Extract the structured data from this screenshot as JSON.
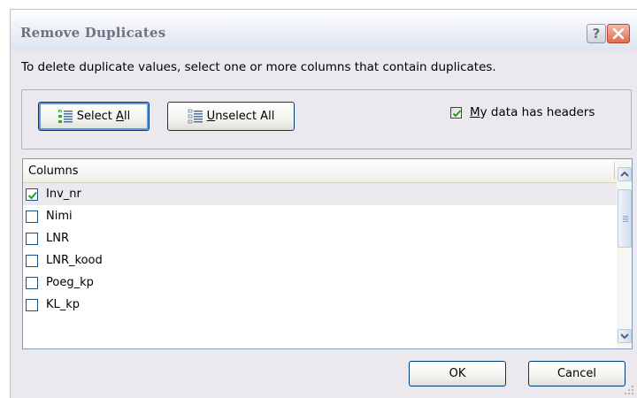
{
  "dialog": {
    "title": "Remove Duplicates",
    "help_label": "?",
    "instructions": "To delete duplicate values, select one or more columns that contain duplicates."
  },
  "toolbar": {
    "select_all_pre": "Select ",
    "select_all_acc": "A",
    "select_all_post": "ll",
    "unselect_all_acc": "U",
    "unselect_all_post": "nselect All"
  },
  "headers_option": {
    "acc": "M",
    "rest": "y data has headers",
    "checked": true
  },
  "columns_list": {
    "header": "Columns",
    "items": [
      {
        "name": "Inv_nr",
        "checked": true,
        "selected": true
      },
      {
        "name": "Nimi",
        "checked": false,
        "selected": false
      },
      {
        "name": "LNR",
        "checked": false,
        "selected": false
      },
      {
        "name": "LNR_kood",
        "checked": false,
        "selected": false
      },
      {
        "name": "Poeg_kp",
        "checked": false,
        "selected": false
      },
      {
        "name": "KL_kp",
        "checked": false,
        "selected": false
      }
    ]
  },
  "footer": {
    "ok_label": "OK",
    "cancel_label": "Cancel"
  },
  "colors": {
    "dialog_bg": "#ebe9ed",
    "check_green": "#21a121",
    "button_border": "#003c74",
    "close_red": "#de6d52"
  }
}
